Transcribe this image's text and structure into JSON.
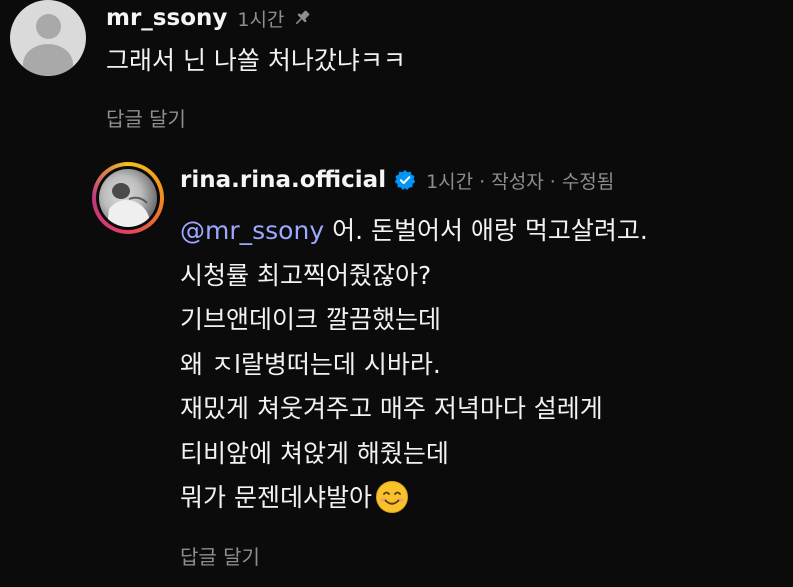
{
  "comment_main": {
    "username": "mr_ssony",
    "time": "1시간",
    "text": "그래서 닌 나쏠 처나갔냐ㅋㅋ",
    "reply_label": "답글 달기",
    "avatar_icon": "default-profile-icon",
    "pin_icon": "pin-icon"
  },
  "comment_reply": {
    "username": "rina.rina.official",
    "verified_icon": "verified-badge-icon",
    "meta": "1시간 · 작성자 · 수정됨",
    "mention": "@mr_ssony",
    "lines": [
      " 어. 돈벌어서 애랑 먹고살려고.",
      "시청률 최고찍어줬잖아?",
      "기브앤데이크 깔끔했는데",
      "왜 ㅈl랄병떠는데 시바라.",
      "재밌게 쳐웃겨주고 매주 저녁마다 설레게",
      "티비앞에 쳐앉게 해줬는데",
      "뭐가 문젠데샤발아"
    ],
    "emoji": "smiling-face-emoji",
    "reply_label": "답글 달기"
  },
  "colors": {
    "background": "#0b0b0b",
    "text": "#f2f2f2",
    "secondary": "#8e8e8e",
    "mention": "#9ea8ff",
    "verified": "#0095f6"
  }
}
